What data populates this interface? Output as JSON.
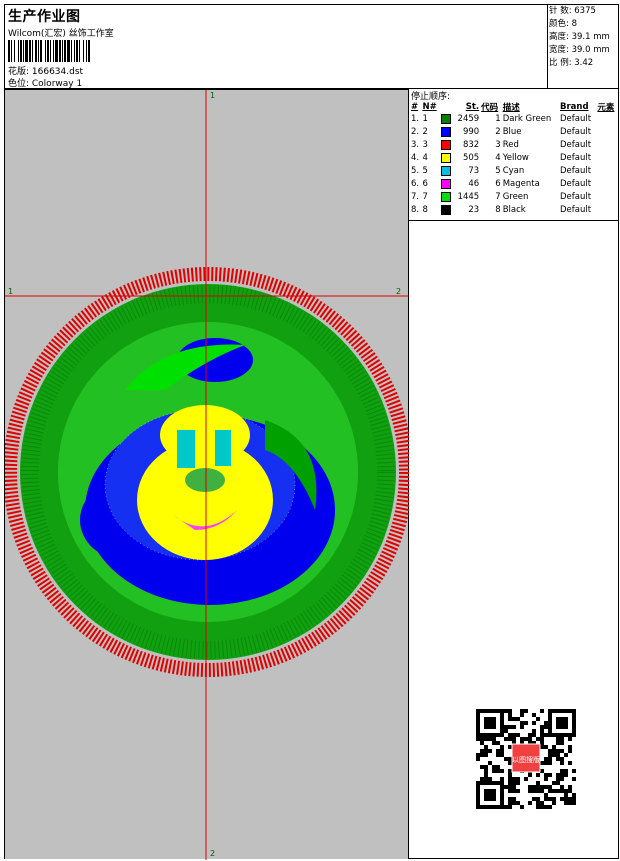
{
  "header": {
    "title": "生产作业图",
    "company": "Wilcom(汇宏) 丝饰工作室",
    "design_label": "花版: 166634.dst",
    "colorway_label": "色位:  Colorway 1"
  },
  "stats": {
    "stitches": "针 数: 6375",
    "colors": "颜色: 8",
    "height": "高度: 39.1 mm",
    "width": "宽度: 39.0 mm",
    "ratio": "比 例: 3.42"
  },
  "canvas": {
    "marker_top": "1",
    "marker_left": "1",
    "marker_right": "2",
    "marker_bottom": "2"
  },
  "stop_sequence": {
    "title": "停止顺序:",
    "headers": [
      "#",
      "N#",
      "St.",
      "代码",
      "描述",
      "Brand",
      "元素"
    ],
    "rows": [
      {
        "idx": "1.",
        "n": "1",
        "color": "#008000",
        "st": "2459",
        "code": "1",
        "desc": "Dark Green",
        "brand": "Default"
      },
      {
        "idx": "2.",
        "n": "2",
        "color": "#0000ff",
        "st": "990",
        "code": "2",
        "desc": "Blue",
        "brand": "Default"
      },
      {
        "idx": "3.",
        "n": "3",
        "color": "#ff0000",
        "st": "832",
        "code": "3",
        "desc": "Red",
        "brand": "Default"
      },
      {
        "idx": "4.",
        "n": "4",
        "color": "#ffff00",
        "st": "505",
        "code": "4",
        "desc": "Yellow",
        "brand": "Default"
      },
      {
        "idx": "5.",
        "n": "5",
        "color": "#00c0e0",
        "st": "73",
        "code": "5",
        "desc": "Cyan",
        "brand": "Default"
      },
      {
        "idx": "6.",
        "n": "6",
        "color": "#ff00ff",
        "st": "46",
        "code": "6",
        "desc": "Magenta",
        "brand": "Default"
      },
      {
        "idx": "7.",
        "n": "7",
        "color": "#00e000",
        "st": "1445",
        "code": "7",
        "desc": "Green",
        "brand": "Default"
      },
      {
        "idx": "8.",
        "n": "8",
        "color": "#000000",
        "st": "23",
        "code": "8",
        "desc": "Black",
        "brand": "Default"
      }
    ]
  },
  "qr": {
    "stamp_text": "以图搜版"
  }
}
